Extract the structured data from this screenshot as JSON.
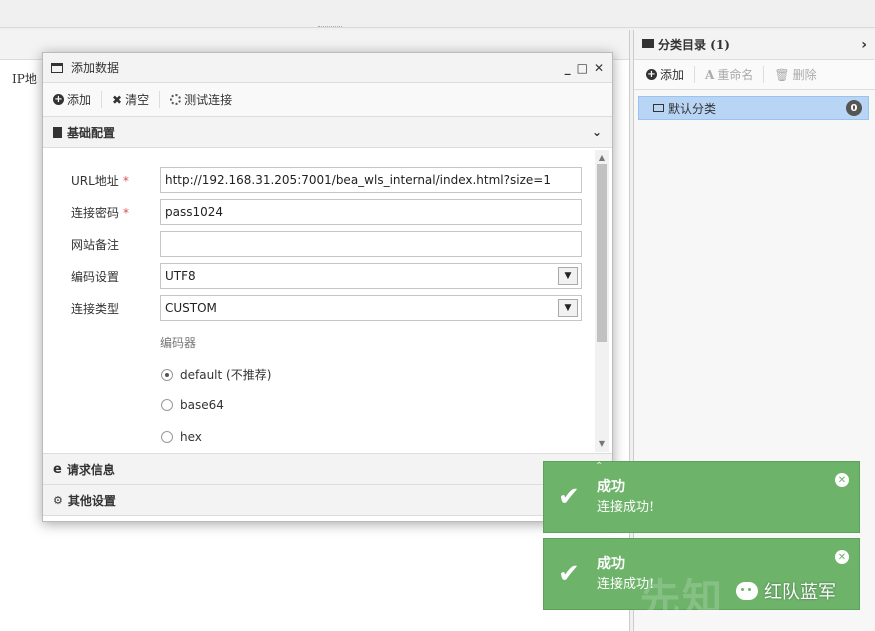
{
  "left": {
    "ip_column": "IP地"
  },
  "category": {
    "title": "分类目录 (1)",
    "toolbar": {
      "add": "添加",
      "rename": "重命名",
      "delete": "删除"
    },
    "items": [
      {
        "label": "默认分类",
        "count": "0"
      }
    ]
  },
  "dialog": {
    "title": "添加数据",
    "toolbar": {
      "add": "添加",
      "clear": "清空",
      "test": "测试连接"
    },
    "sections": {
      "basic": "基础配置",
      "request": "请求信息",
      "other": "其他设置"
    },
    "fields": {
      "url_label": "URL地址",
      "url_value": "http://192.168.31.205:7001/bea_wls_internal/index.html?size=1",
      "password_label": "连接密码",
      "password_value": "pass1024",
      "note_label": "网站备注",
      "note_value": "",
      "encoding_label": "编码设置",
      "encoding_value": "UTF8",
      "type_label": "连接类型",
      "type_value": "CUSTOM",
      "encoder_label": "编码器",
      "encoders": [
        {
          "label": "default (不推荐)",
          "checked": true
        },
        {
          "label": "base64",
          "checked": false
        },
        {
          "label": "hex",
          "checked": false
        }
      ]
    }
  },
  "toasts": [
    {
      "title": "成功",
      "message": "连接成功!"
    },
    {
      "title": "成功",
      "message": "连接成功!"
    }
  ],
  "watermark": {
    "bg_text": "先知",
    "text": "红队蓝军"
  },
  "colors": {
    "toast": "#6db36a",
    "selected": "#b8d5f5",
    "required": "#d9534f"
  }
}
